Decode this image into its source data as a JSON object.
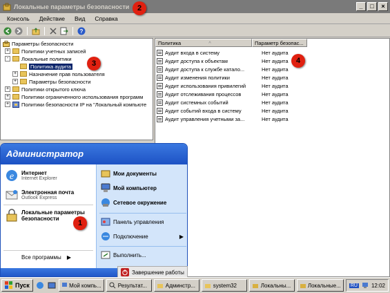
{
  "window": {
    "title": "Локальные параметры безопасности",
    "controls": [
      "_",
      "□",
      "×"
    ]
  },
  "menu": [
    "Консоль",
    "Действие",
    "Вид",
    "Справка"
  ],
  "toolbar_icons": [
    "back-arrow-icon",
    "forward-arrow-icon",
    "up-folder-icon",
    "delete-icon",
    "export-icon",
    "help-icon"
  ],
  "tree": {
    "root": "Параметры безопасности",
    "items": [
      {
        "label": "Политики учетных записей",
        "expander": "+"
      },
      {
        "label": "Локальные политики",
        "expander": "-"
      },
      {
        "label": "Политика аудита",
        "expander": ""
      },
      {
        "label": "Назначение прав пользователя",
        "expander": "+"
      },
      {
        "label": "Параметры безопасности",
        "expander": "+"
      },
      {
        "label": "Политики открытого ключа",
        "expander": "+"
      },
      {
        "label": "Политики ограниченного использования программ",
        "expander": "+"
      },
      {
        "label": "Политики безопасности IP на \"Локальный компьюте",
        "expander": "+"
      }
    ]
  },
  "list": {
    "columns": [
      "Политика",
      "Параметр безопас..."
    ],
    "rows": [
      {
        "policy": "Аудит входа в систему",
        "value": "Нет аудита"
      },
      {
        "policy": "Аудит доступа к объектам",
        "value": "Нет аудита"
      },
      {
        "policy": "Аудит доступа к службе катало...",
        "value": "Нет аудита"
      },
      {
        "policy": "Аудит изменения политики",
        "value": "Нет аудита"
      },
      {
        "policy": "Аудит использования привилегий",
        "value": "Нет аудита"
      },
      {
        "policy": "Аудит отслеживания процессов",
        "value": "Нет аудита"
      },
      {
        "policy": "Аудит системных событий",
        "value": "Нет аудита"
      },
      {
        "policy": "Аудит событий входа в систему",
        "value": "Нет аудита"
      },
      {
        "policy": "Аудит управления учетными за...",
        "value": "Нет аудита"
      }
    ]
  },
  "markers": [
    "1",
    "2",
    "3",
    "4"
  ],
  "start_menu": {
    "user": "Администратор",
    "left": [
      {
        "title": "Интернет",
        "sub": "Internet Explorer"
      },
      {
        "title": "Электронная почта",
        "sub": "Outlook Express"
      },
      {
        "title": "Локальные параметры безопасности",
        "sub": ""
      }
    ],
    "all_programs": "Все программы",
    "right": [
      "Мои документы",
      "Мой компьютер",
      "Сетевое окружение",
      "Панель управления",
      "Подключение",
      "Выполнить..."
    ],
    "shutdown": "Завершение работы"
  },
  "taskbar": {
    "start": "Пуск",
    "buttons": [
      "Мой компь...",
      "Результат...",
      "Админстр...",
      "system32",
      "Локальны...",
      "Локальные..."
    ],
    "lang": "RU",
    "clock": "12:02"
  },
  "colors": {
    "marker": "#e02010",
    "selection": "#0a246a",
    "startmenu_blue": "#1d52c4"
  }
}
